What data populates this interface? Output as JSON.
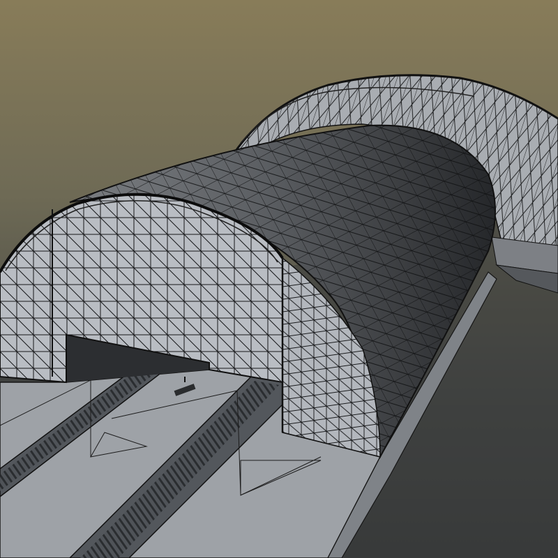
{
  "scene": {
    "subject": "wireframe-render",
    "colors": {
      "sky_top": "#877b5a",
      "sky_mid": "#6b6752",
      "ground": "#3b3d3d",
      "panel_face": "#b8bcc2",
      "roof_light": "#6d7074",
      "roof_dark": "#2a2c2e",
      "platform": "#9fa3a8",
      "track_bed": "#5a5e63",
      "wire": "#141516"
    }
  }
}
